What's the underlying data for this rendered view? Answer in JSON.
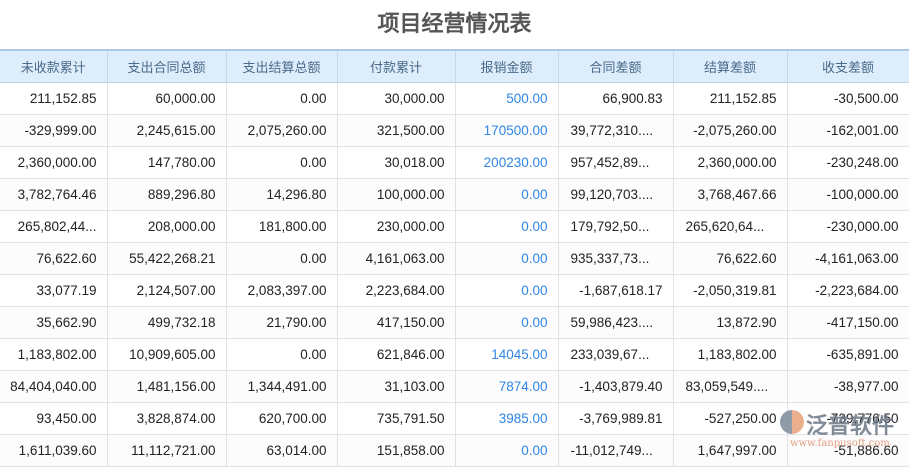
{
  "title": "项目经营情况表",
  "columns": [
    "未收款累计",
    "支出合同总额",
    "支出结算总额",
    "付款累计",
    "报销金额",
    "合同差额",
    "结算差额",
    "收支差额"
  ],
  "rows": [
    [
      "211,152.85",
      "60,000.00",
      "0.00",
      "30,000.00",
      "500.00",
      "66,900.83",
      "211,152.85",
      "-30,500.00"
    ],
    [
      "-329,999.00",
      "2,245,615.00",
      "2,075,260.00",
      "321,500.00",
      "170500.00",
      "39,772,310....",
      "-2,075,260.00",
      "-162,001.00"
    ],
    [
      "2,360,000.00",
      "147,780.00",
      "0.00",
      "30,018.00",
      "200230.00",
      "957,452,89...",
      "2,360,000.00",
      "-230,248.00"
    ],
    [
      "3,782,764.46",
      "889,296.80",
      "14,296.80",
      "100,000.00",
      "0.00",
      "99,120,703....",
      "3,768,467.66",
      "-100,000.00"
    ],
    [
      "265,802,44...",
      "208,000.00",
      "181,800.00",
      "230,000.00",
      "0.00",
      "179,792,50...",
      "265,620,64...",
      "-230,000.00"
    ],
    [
      "76,622.60",
      "55,422,268.21",
      "0.00",
      "4,161,063.00",
      "0.00",
      "935,337,73...",
      "76,622.60",
      "-4,161,063.00"
    ],
    [
      "33,077.19",
      "2,124,507.00",
      "2,083,397.00",
      "2,223,684.00",
      "0.00",
      "-1,687,618.17",
      "-2,050,319.81",
      "-2,223,684.00"
    ],
    [
      "35,662.90",
      "499,732.18",
      "21,790.00",
      "417,150.00",
      "0.00",
      "59,986,423....",
      "13,872.90",
      "-417,150.00"
    ],
    [
      "1,183,802.00",
      "10,909,605.00",
      "0.00",
      "621,846.00",
      "14045.00",
      "233,039,67...",
      "1,183,802.00",
      "-635,891.00"
    ],
    [
      "84,404,040.00",
      "1,481,156.00",
      "1,344,491.00",
      "31,103.00",
      "7874.00",
      "-1,403,879.40",
      "83,059,549....",
      "-38,977.00"
    ],
    [
      "93,450.00",
      "3,828,874.00",
      "620,700.00",
      "735,791.50",
      "3985.00",
      "-3,769,989.81",
      "-527,250.00",
      "-739,776.50"
    ],
    [
      "1,611,039.60",
      "11,112,721.00",
      "63,014.00",
      "151,858.00",
      "0.00",
      "-11,012,749...",
      "1,647,997.00",
      "-51,886.60"
    ]
  ],
  "watermark": {
    "name": "泛普软件",
    "url": "www.fanpusoft.com"
  }
}
